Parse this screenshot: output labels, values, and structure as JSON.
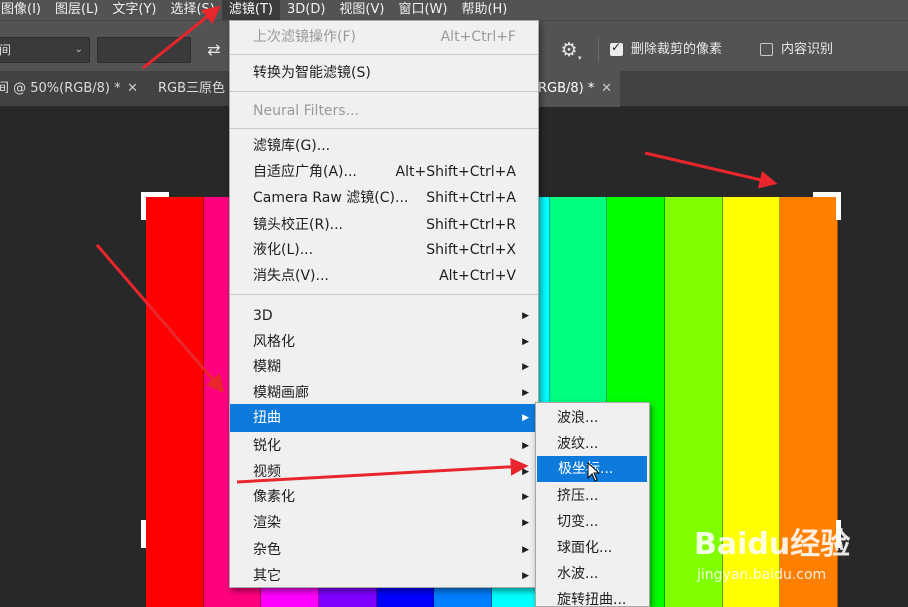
{
  "menubar": {
    "items": [
      "图像(I)",
      "图层(L)",
      "文字(Y)",
      "选择(S)",
      "滤镜(T)",
      "3D(D)",
      "视图(V)",
      "窗口(W)",
      "帮助(H)"
    ]
  },
  "options": {
    "select_value": "间",
    "checkbox_delete_cropped": {
      "label": "删除裁剪的像素",
      "checked": true
    },
    "checkbox_content_aware": {
      "label": "内容识别",
      "checked": false
    }
  },
  "tabs": [
    {
      "label": "间 @ 50%(RGB/8) *"
    },
    {
      "label": "RGB三原色"
    },
    {
      "label": "RGB/8) *"
    }
  ],
  "filter_menu": {
    "items": [
      {
        "label": "上次滤镜操作(F)",
        "shortcut": "Alt+Ctrl+F",
        "disabled": true
      },
      {
        "label": "转换为智能滤镜(S)",
        "shortcut": ""
      },
      {
        "label": "Neural Filters...",
        "shortcut": "",
        "disabled": true
      },
      {
        "label": "滤镜库(G)...",
        "shortcut": ""
      },
      {
        "label": "自适应广角(A)...",
        "shortcut": "Alt+Shift+Ctrl+A"
      },
      {
        "label": "Camera Raw 滤镜(C)...",
        "shortcut": "Shift+Ctrl+A"
      },
      {
        "label": "镜头校正(R)...",
        "shortcut": "Shift+Ctrl+R"
      },
      {
        "label": "液化(L)...",
        "shortcut": "Shift+Ctrl+X"
      },
      {
        "label": "消失点(V)...",
        "shortcut": "Alt+Ctrl+V"
      },
      {
        "label": "3D",
        "submenu": true
      },
      {
        "label": "风格化",
        "submenu": true
      },
      {
        "label": "模糊",
        "submenu": true
      },
      {
        "label": "模糊画廊",
        "submenu": true
      },
      {
        "label": "扭曲",
        "submenu": true,
        "highlighted": true
      },
      {
        "label": "锐化",
        "submenu": true
      },
      {
        "label": "视频",
        "submenu": true
      },
      {
        "label": "像素化",
        "submenu": true
      },
      {
        "label": "渲染",
        "submenu": true
      },
      {
        "label": "杂色",
        "submenu": true
      },
      {
        "label": "其它",
        "submenu": true
      }
    ]
  },
  "distort_submenu": {
    "items": [
      {
        "label": "波浪..."
      },
      {
        "label": "波纹..."
      },
      {
        "label": "极坐标...",
        "highlighted": true
      },
      {
        "label": "挤压..."
      },
      {
        "label": "切变..."
      },
      {
        "label": "球面化..."
      },
      {
        "label": "水波..."
      },
      {
        "label": "旋转扭曲..."
      }
    ]
  },
  "canvas": {
    "stripe_colors": [
      "#ff0000",
      "#ff007f",
      "#ff00ff",
      "#7f00ff",
      "#0000ff",
      "#007fff",
      "#00ffff",
      "#00ff7f",
      "#00ff00",
      "#7fff00",
      "#ffff00",
      "#ff7f00"
    ]
  },
  "colors": {
    "menu_highlight": "#0e7bdc",
    "annotation_arrow": "#e8262c"
  },
  "watermark": {
    "logo": "Baidu经验",
    "url": "jingyan.baidu.com"
  }
}
